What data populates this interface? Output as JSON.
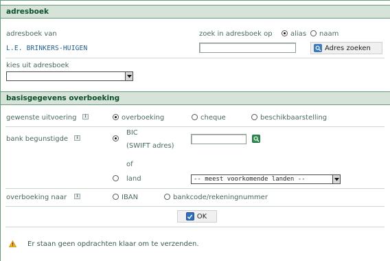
{
  "address_book": {
    "header": "adresboek",
    "owner_label": "adresboek van",
    "owner_value": "L.E. BRINKERS-HUIGEN",
    "search_label": "zoek in adresboek op",
    "search_option_alias": "alias",
    "search_option_name": "naam",
    "search_value": "",
    "search_button": "Adres zoeken",
    "choose_label": "kies uit adresboek",
    "choose_value": ""
  },
  "transfer": {
    "header": "basisgegevens overboeking",
    "execution_label": "gewenste uitvoering",
    "execution_options": [
      "overboeking",
      "cheque",
      "beschikbaarstelling"
    ],
    "beneficiary_bank_label": "bank begunstigde",
    "bic_line1": "BIC",
    "bic_line2": "(SWIFT adres)",
    "bic_value": "",
    "or_text": "of",
    "country_label": "land",
    "country_select": "-- meest voorkomende landen --",
    "transfer_to_label": "overboeking naar",
    "transfer_to_options": [
      "IBAN",
      "bankcode/rekeningnummer"
    ],
    "ok_button": "OK"
  },
  "notice": {
    "text": "Er staan geen opdrachten klaar om te verzenden."
  },
  "colors": {
    "header_bg": "#d6e3d8",
    "header_text": "#0f4f2b",
    "accent_green": "#2f8f4f",
    "link_blue": "#1f5f8f",
    "warning": "#f2b01e"
  },
  "icons": [
    "info-icon",
    "search-icon",
    "ok-check-icon",
    "warning-icon",
    "chevron-down-icon"
  ]
}
